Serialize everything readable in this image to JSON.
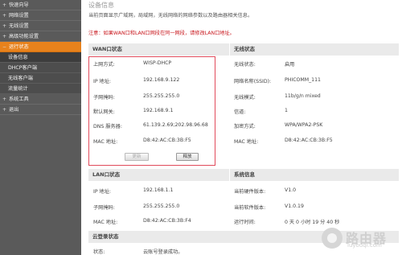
{
  "sidebar": {
    "items": [
      {
        "label": "快速向导",
        "arrow": "+"
      },
      {
        "label": "网络设置",
        "arrow": "+"
      },
      {
        "label": "无线设置",
        "arrow": "+"
      },
      {
        "label": "高级功能设置",
        "arrow": "+"
      },
      {
        "label": "运行状态",
        "arrow": "−"
      }
    ],
    "subitems": [
      {
        "label": "设备信息"
      },
      {
        "label": "DHCP客户端"
      },
      {
        "label": "无线客户端"
      },
      {
        "label": "流量统计"
      }
    ],
    "items_after": [
      {
        "label": "系统工具",
        "arrow": "+"
      },
      {
        "label": "退出",
        "arrow": "+"
      }
    ]
  },
  "main": {
    "title": "设备信息",
    "intro": "当前页面显示广域网，局域网，无线网络的网络参数以及路由器相关信息。",
    "note": "注意：如果WAN口和LAN口网段在同一网段，请修改LAN口地址。"
  },
  "wan": {
    "title": "WAN口状态",
    "rows": [
      {
        "label": "上网方式:",
        "value": "WISP-DHCP"
      },
      {
        "label": "IP 地址:",
        "value": "192.168.9.122"
      },
      {
        "label": "子网掩码:",
        "value": "255.255.255.0"
      },
      {
        "label": "默认网关:",
        "value": "192.168.9.1"
      },
      {
        "label": "DNS 服务器:",
        "value": "61.139.2.69;202.98.96.68"
      },
      {
        "label": "MAC 地址:",
        "value": "D8:42:AC:CB:3B:F5"
      }
    ],
    "renew_label": "更新",
    "release_label": "释放"
  },
  "wireless": {
    "title": "无线状态",
    "rows": [
      {
        "label": "无线状态:",
        "value": "启用"
      },
      {
        "label": "网络名称(SSID):",
        "value": "PHICOMM_111"
      },
      {
        "label": "无线模式:",
        "value": "11b/g/n mixed"
      },
      {
        "label": "信道:",
        "value": "1"
      },
      {
        "label": "加密方式:",
        "value": "WPA/WPA2-PSK"
      },
      {
        "label": "MAC 地址:",
        "value": "D8:42:AC:CB:3B:F5"
      }
    ]
  },
  "lan": {
    "title": "LAN口状态",
    "rows": [
      {
        "label": "IP 地址:",
        "value": "192.168.1.1"
      },
      {
        "label": "子网掩码:",
        "value": "255.255.255.0"
      },
      {
        "label": "MAC 地址:",
        "value": "D8:42:AC:CB:3B:F4"
      }
    ]
  },
  "system": {
    "title": "系统信息",
    "rows": [
      {
        "label": "当前硬件版本:",
        "value": "V1.0"
      },
      {
        "label": "当前软件版本:",
        "value": "V1.0.19"
      },
      {
        "label": "运行时间:",
        "value": "0 天 0 小时 19 分 40 秒"
      }
    ]
  },
  "cloud": {
    "title": "云登录状态",
    "rows": [
      {
        "label": "状态:",
        "value": "云账号登录成功。"
      }
    ]
  },
  "watermark": {
    "text": "路由器",
    "url": "luyouqi.com"
  },
  "colors": {
    "sidebar_bg": "#5a5a5a",
    "active": "#e8821c",
    "note_red": "#c8151b",
    "highlight_box": "#e14a5b"
  }
}
